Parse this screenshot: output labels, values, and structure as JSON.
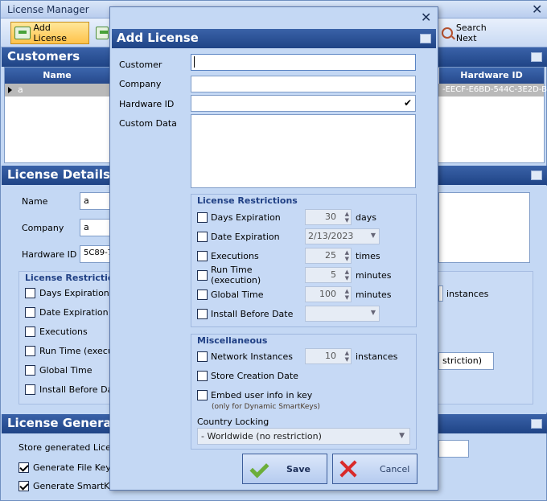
{
  "main": {
    "title": "License Manager",
    "toolbar": {
      "add_license": "Add License",
      "search_next": "Search Next"
    },
    "customers": {
      "heading": "Customers",
      "columns": [
        "Name",
        "Hardware ID"
      ],
      "row": {
        "name": "a",
        "hardware_id": "-EECF-E6BD-544C-3E2D-BF"
      }
    },
    "details": {
      "heading": "License Details",
      "name_label": "Name",
      "name_value": "a",
      "company_label": "Company",
      "company_value": "a",
      "hwid_label": "Hardware ID",
      "hwid_value": "5C89-73",
      "restrictions_title": "License Restrictions",
      "restrictions": [
        "Days Expiration",
        "Date Expiration",
        "Executions",
        "Run Time (executio",
        "Global Time",
        "Install Before Date"
      ],
      "instances_unit": "instances",
      "country_partial": "striction)"
    },
    "generation": {
      "heading": "License Generation",
      "store_label": "Store generated License",
      "gen_file_key": "Generate File Key",
      "gen_smart_key": "Generate SmartKey"
    }
  },
  "dialog": {
    "title": "Add License",
    "labels": {
      "customer": "Customer",
      "company": "Company",
      "hardware_id": "Hardware ID",
      "custom_data": "Custom Data"
    },
    "values": {
      "customer": "",
      "company": "",
      "hardware_id": "",
      "custom_data": ""
    },
    "restrictions": {
      "title": "License Restrictions",
      "days_expiration": {
        "label": "Days Expiration",
        "value": "30",
        "unit": "days"
      },
      "date_expiration": {
        "label": "Date Expiration",
        "value": "2/13/2023"
      },
      "executions": {
        "label": "Executions",
        "value": "25",
        "unit": "times"
      },
      "run_time": {
        "label": "Run Time (execution)",
        "value": "5",
        "unit": "minutes"
      },
      "global_time": {
        "label": "Global Time",
        "value": "100",
        "unit": "minutes"
      },
      "install_before": {
        "label": "Install Before Date",
        "value": ""
      }
    },
    "misc": {
      "title": "Miscellaneous",
      "network_instances": {
        "label": "Network Instances",
        "value": "10",
        "unit": "instances"
      },
      "store_creation_date": "Store Creation Date",
      "embed_user_info": "Embed user info in key",
      "embed_note": "(only for Dynamic SmartKeys)",
      "country_locking_label": "Country Locking",
      "country_locking_value": "- Worldwide (no restriction)"
    },
    "buttons": {
      "save": "Save",
      "cancel": "Cancel"
    }
  }
}
